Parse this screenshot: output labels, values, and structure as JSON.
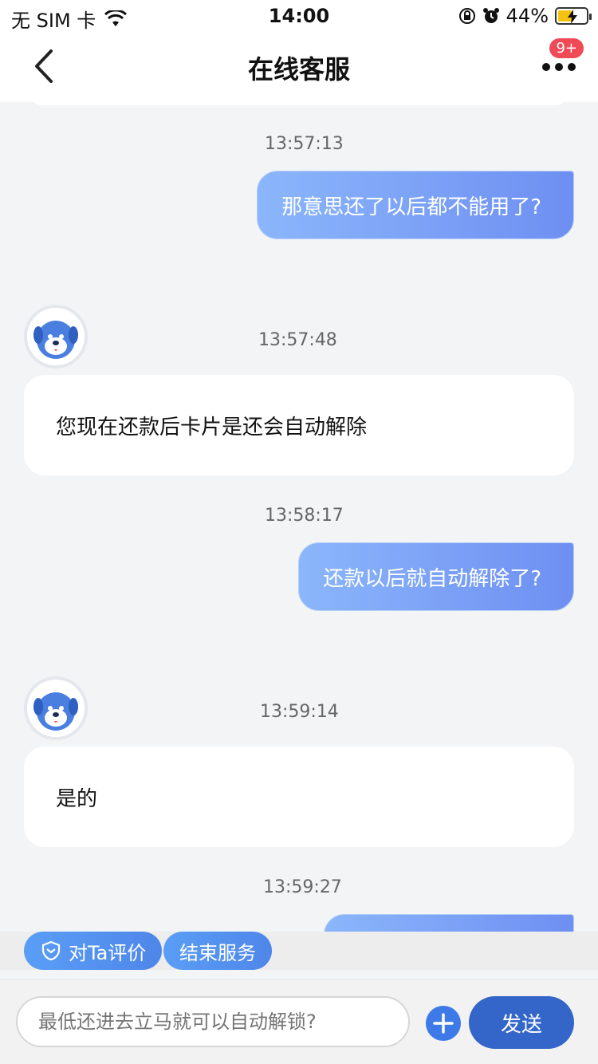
{
  "status": {
    "carrier": "无 SIM 卡",
    "time": "14:00",
    "battery": "44%"
  },
  "nav": {
    "title": "在线客服",
    "badge": "9+"
  },
  "messages": [
    {
      "time": "13:57:13",
      "from": "user",
      "text": "那意思还了以后都不能用了?"
    },
    {
      "time": "13:57:48",
      "from": "agent",
      "text": "您现在还款后卡片是还会自动解除"
    },
    {
      "time": "13:58:17",
      "from": "user",
      "text": "还款以后就自动解除了?"
    },
    {
      "time": "13:59:14",
      "from": "agent",
      "text": "是的"
    },
    {
      "time": "13:59:27",
      "from": "user",
      "text": ""
    }
  ],
  "quick_actions": {
    "rate": "对Ta评价",
    "end": "结束服务"
  },
  "input": {
    "placeholder": "最低还进去立马就可以自动解锁?"
  },
  "send_label": "发送",
  "colors": {
    "accent": "#3466c9",
    "bubble_start": "#8bb6fb",
    "bubble_end": "#6e8ff2",
    "badge": "#ef4a55"
  },
  "icons": {
    "back": "chevron-left-icon",
    "more": "more-dots-icon",
    "avatar": "robot-dog-avatar",
    "plus": "plus-icon"
  }
}
